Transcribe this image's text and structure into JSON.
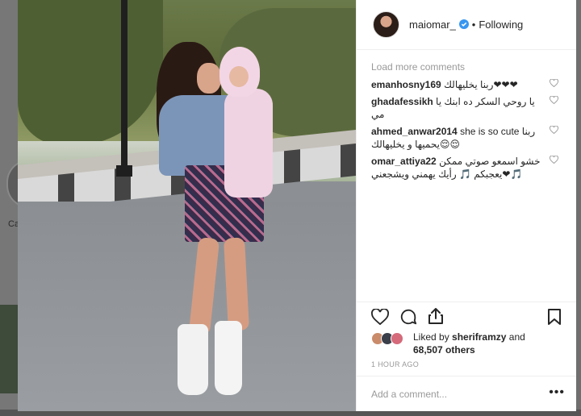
{
  "background": {
    "partial_label": "Ca"
  },
  "post": {
    "username": "maiomar_",
    "separator": "•",
    "follow_state": "Following",
    "load_more": "Load more comments",
    "comments": [
      {
        "user": "emanhosny169",
        "text": "ربنا يخليهالك❤❤❤"
      },
      {
        "user": "ghadafessikh",
        "text": "يا روحي السكر ده ابنك يا مي"
      },
      {
        "user": "ahmed_anwar2014",
        "text": "she is so cute ربنا يحميها و يخليهالك😌😌"
      },
      {
        "user": "omar_attiya22",
        "text": "خشو اسمعو صوتي ممكن يعجبكم 🎵 رأيك يهمني ويشجعني❤🎵"
      }
    ],
    "likes": {
      "prefix": "Liked by",
      "first_liker": "sheriframzy",
      "and": "and",
      "others": "68,507 others"
    },
    "timestamp": "1 HOUR AGO",
    "comment_placeholder": "Add a comment...",
    "more_label": "•••"
  },
  "colors": {
    "verified": "#3897f0",
    "muted": "#999999",
    "text": "#262626"
  }
}
